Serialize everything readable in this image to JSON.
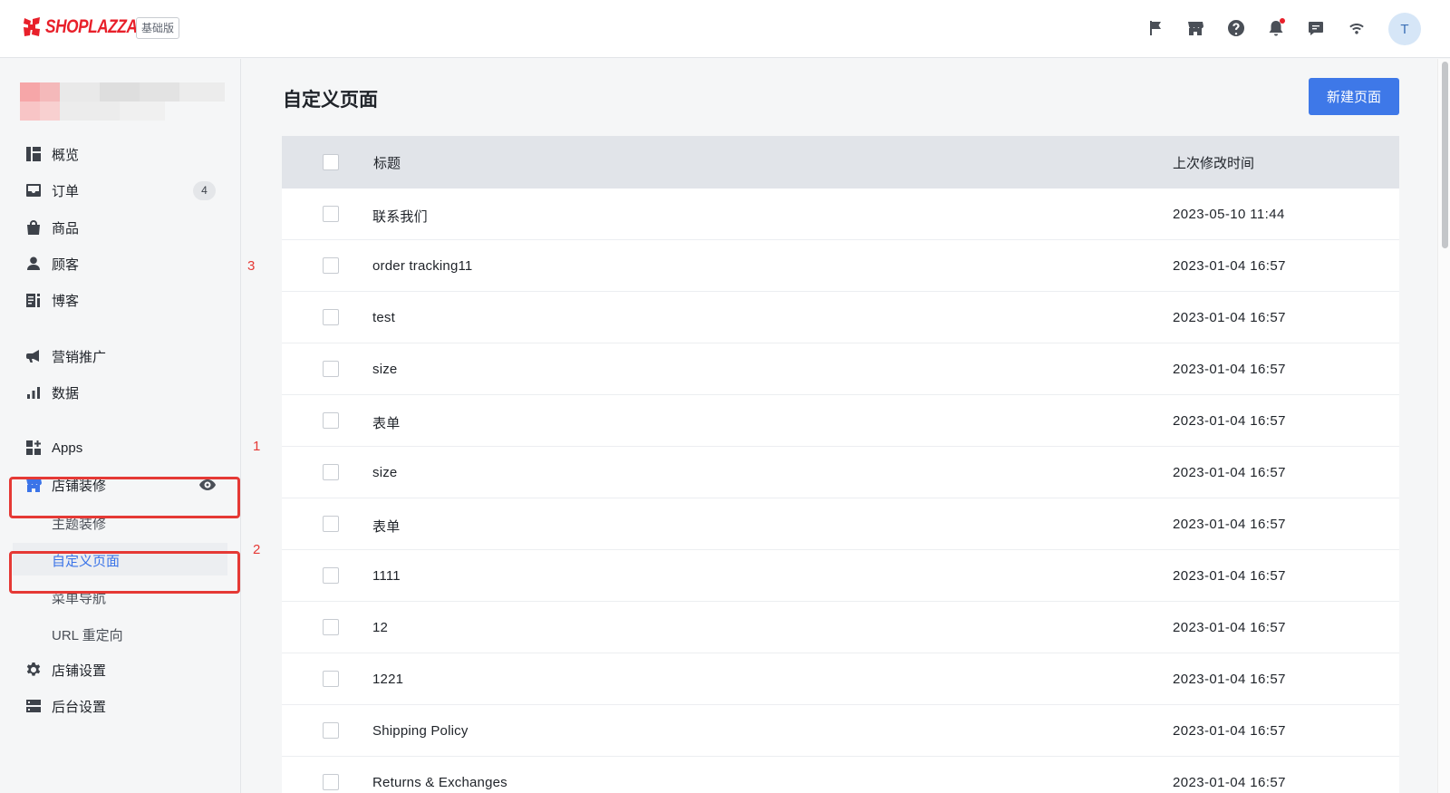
{
  "header": {
    "logo_text": "SHOPLAZZA",
    "plan_badge": "基础版",
    "avatar_initial": "T",
    "icons": [
      "flag-icon",
      "store-icon",
      "help-icon",
      "bell-icon",
      "chat-icon",
      "wifi-icon"
    ]
  },
  "sidebar": {
    "items": [
      {
        "label": "概览",
        "icon": "dashboard-icon"
      },
      {
        "label": "订单",
        "icon": "inbox-icon",
        "count": "4"
      },
      {
        "label": "商品",
        "icon": "bag-icon"
      },
      {
        "label": "顾客",
        "icon": "person-icon"
      },
      {
        "label": "博客",
        "icon": "blog-icon"
      },
      {
        "label": "营销推广",
        "icon": "megaphone-icon"
      },
      {
        "label": "数据",
        "icon": "bar-chart-icon"
      },
      {
        "label": "Apps",
        "icon": "apps-icon"
      },
      {
        "label": "店铺装修",
        "icon": "storefront-icon"
      },
      {
        "label": "店铺设置",
        "icon": "gear-icon"
      },
      {
        "label": "后台设置",
        "icon": "server-icon"
      }
    ],
    "sub_items": [
      {
        "label": "主题装修"
      },
      {
        "label": "自定义页面"
      },
      {
        "label": "菜单导航"
      },
      {
        "label": "URL 重定向"
      }
    ]
  },
  "annotations": [
    "1",
    "2",
    "3"
  ],
  "main": {
    "title": "自定义页面",
    "new_button": "新建页面",
    "table": {
      "col_title": "标题",
      "col_time": "上次修改时间",
      "rows": [
        {
          "title": "联系我们",
          "time": "2023-05-10 11:44"
        },
        {
          "title": "order tracking11",
          "time": "2023-01-04 16:57"
        },
        {
          "title": "test",
          "time": "2023-01-04 16:57"
        },
        {
          "title": "size",
          "time": "2023-01-04 16:57"
        },
        {
          "title": "表单",
          "time": "2023-01-04 16:57"
        },
        {
          "title": "size",
          "time": "2023-01-04 16:57"
        },
        {
          "title": "表单",
          "time": "2023-01-04 16:57"
        },
        {
          "title": "1111",
          "time": "2023-01-04 16:57"
        },
        {
          "title": "12",
          "time": "2023-01-04 16:57"
        },
        {
          "title": "1221",
          "time": "2023-01-04 16:57"
        },
        {
          "title": "Shipping Policy",
          "time": "2023-01-04 16:57"
        },
        {
          "title": "Returns & Exchanges",
          "time": "2023-01-04 16:57"
        }
      ]
    }
  },
  "colors": {
    "brand": "#e8202a",
    "primary": "#3e78e8",
    "annotation": "#e53935"
  }
}
